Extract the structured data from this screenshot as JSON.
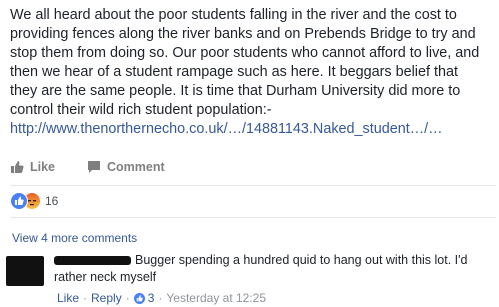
{
  "post": {
    "lines": [
      "We all heard about the poor students falling in the river and the cost to",
      "providing fences along the river banks and on Prebends Bridge to try and",
      "stop them from doing so. Our poor students who cannot afford to live, and",
      "then we hear of a student rampage such as here. It beggars belief that",
      "they are the same people. It is time that Durham University did more to",
      "control their wild rich student population:-"
    ],
    "link": "http://www.thenorthernecho.co.uk/…/14881143.Naked_student…/…"
  },
  "actions": {
    "like": "Like",
    "comment": "Comment"
  },
  "reactions": {
    "count": "16",
    "types": [
      "like-icon",
      "angry-icon"
    ]
  },
  "comments": {
    "more_label": "View 4 more comments",
    "item": {
      "text_line1": "Bugger spending a hundred quid to hang out with this lot. I'd",
      "text_line2": "rather neck myself",
      "like": "Like",
      "reply": "Reply",
      "like_count": "3",
      "time": "Yesterday at 12:25"
    }
  },
  "colors": {
    "link": "#365899",
    "meta": "#90949c",
    "like_blue": "#4a7ff5"
  }
}
